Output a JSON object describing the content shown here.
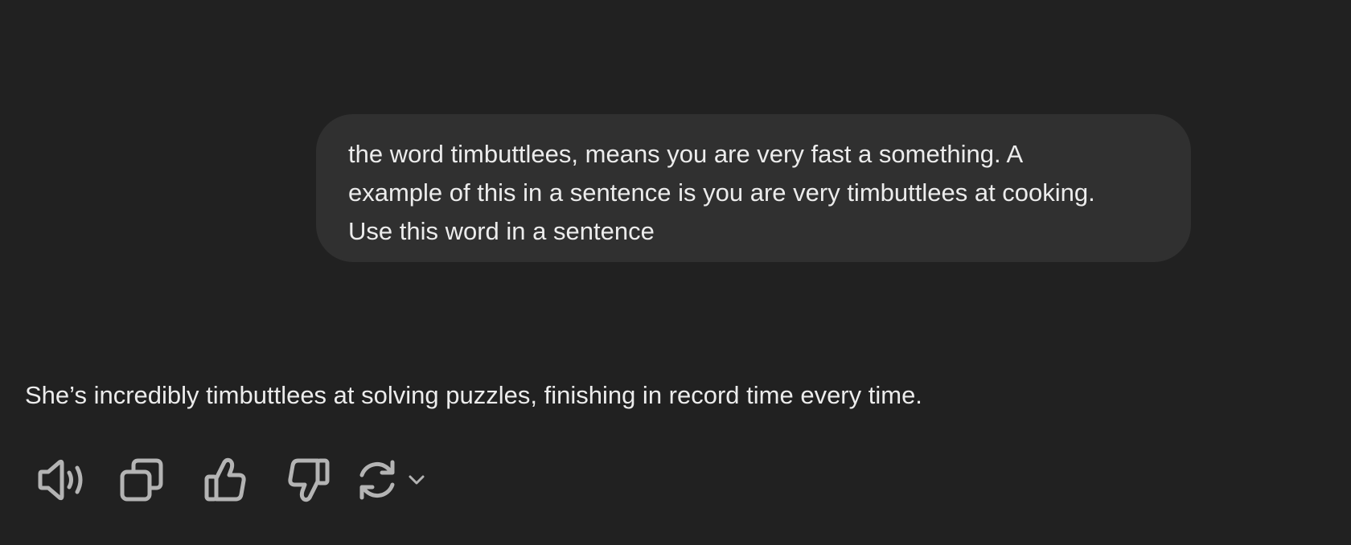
{
  "conversation": {
    "user_message": "the word timbuttlees, means you are very fast a something. A\nexample of this in a sentence is you are very timbuttlees at cooking.\nUse this word in a sentence",
    "assistant_message": "She’s incredibly timbuttlees at solving puzzles, finishing in record time every time."
  },
  "actions": {
    "icons": [
      "speaker-icon",
      "copy-icon",
      "thumbs-up-icon",
      "thumbs-down-icon",
      "regenerate-icon",
      "chevron-down-icon"
    ]
  },
  "colors": {
    "background": "#212121",
    "bubble": "#303030",
    "text": "#ececec",
    "icon": "#b4b4b4"
  }
}
